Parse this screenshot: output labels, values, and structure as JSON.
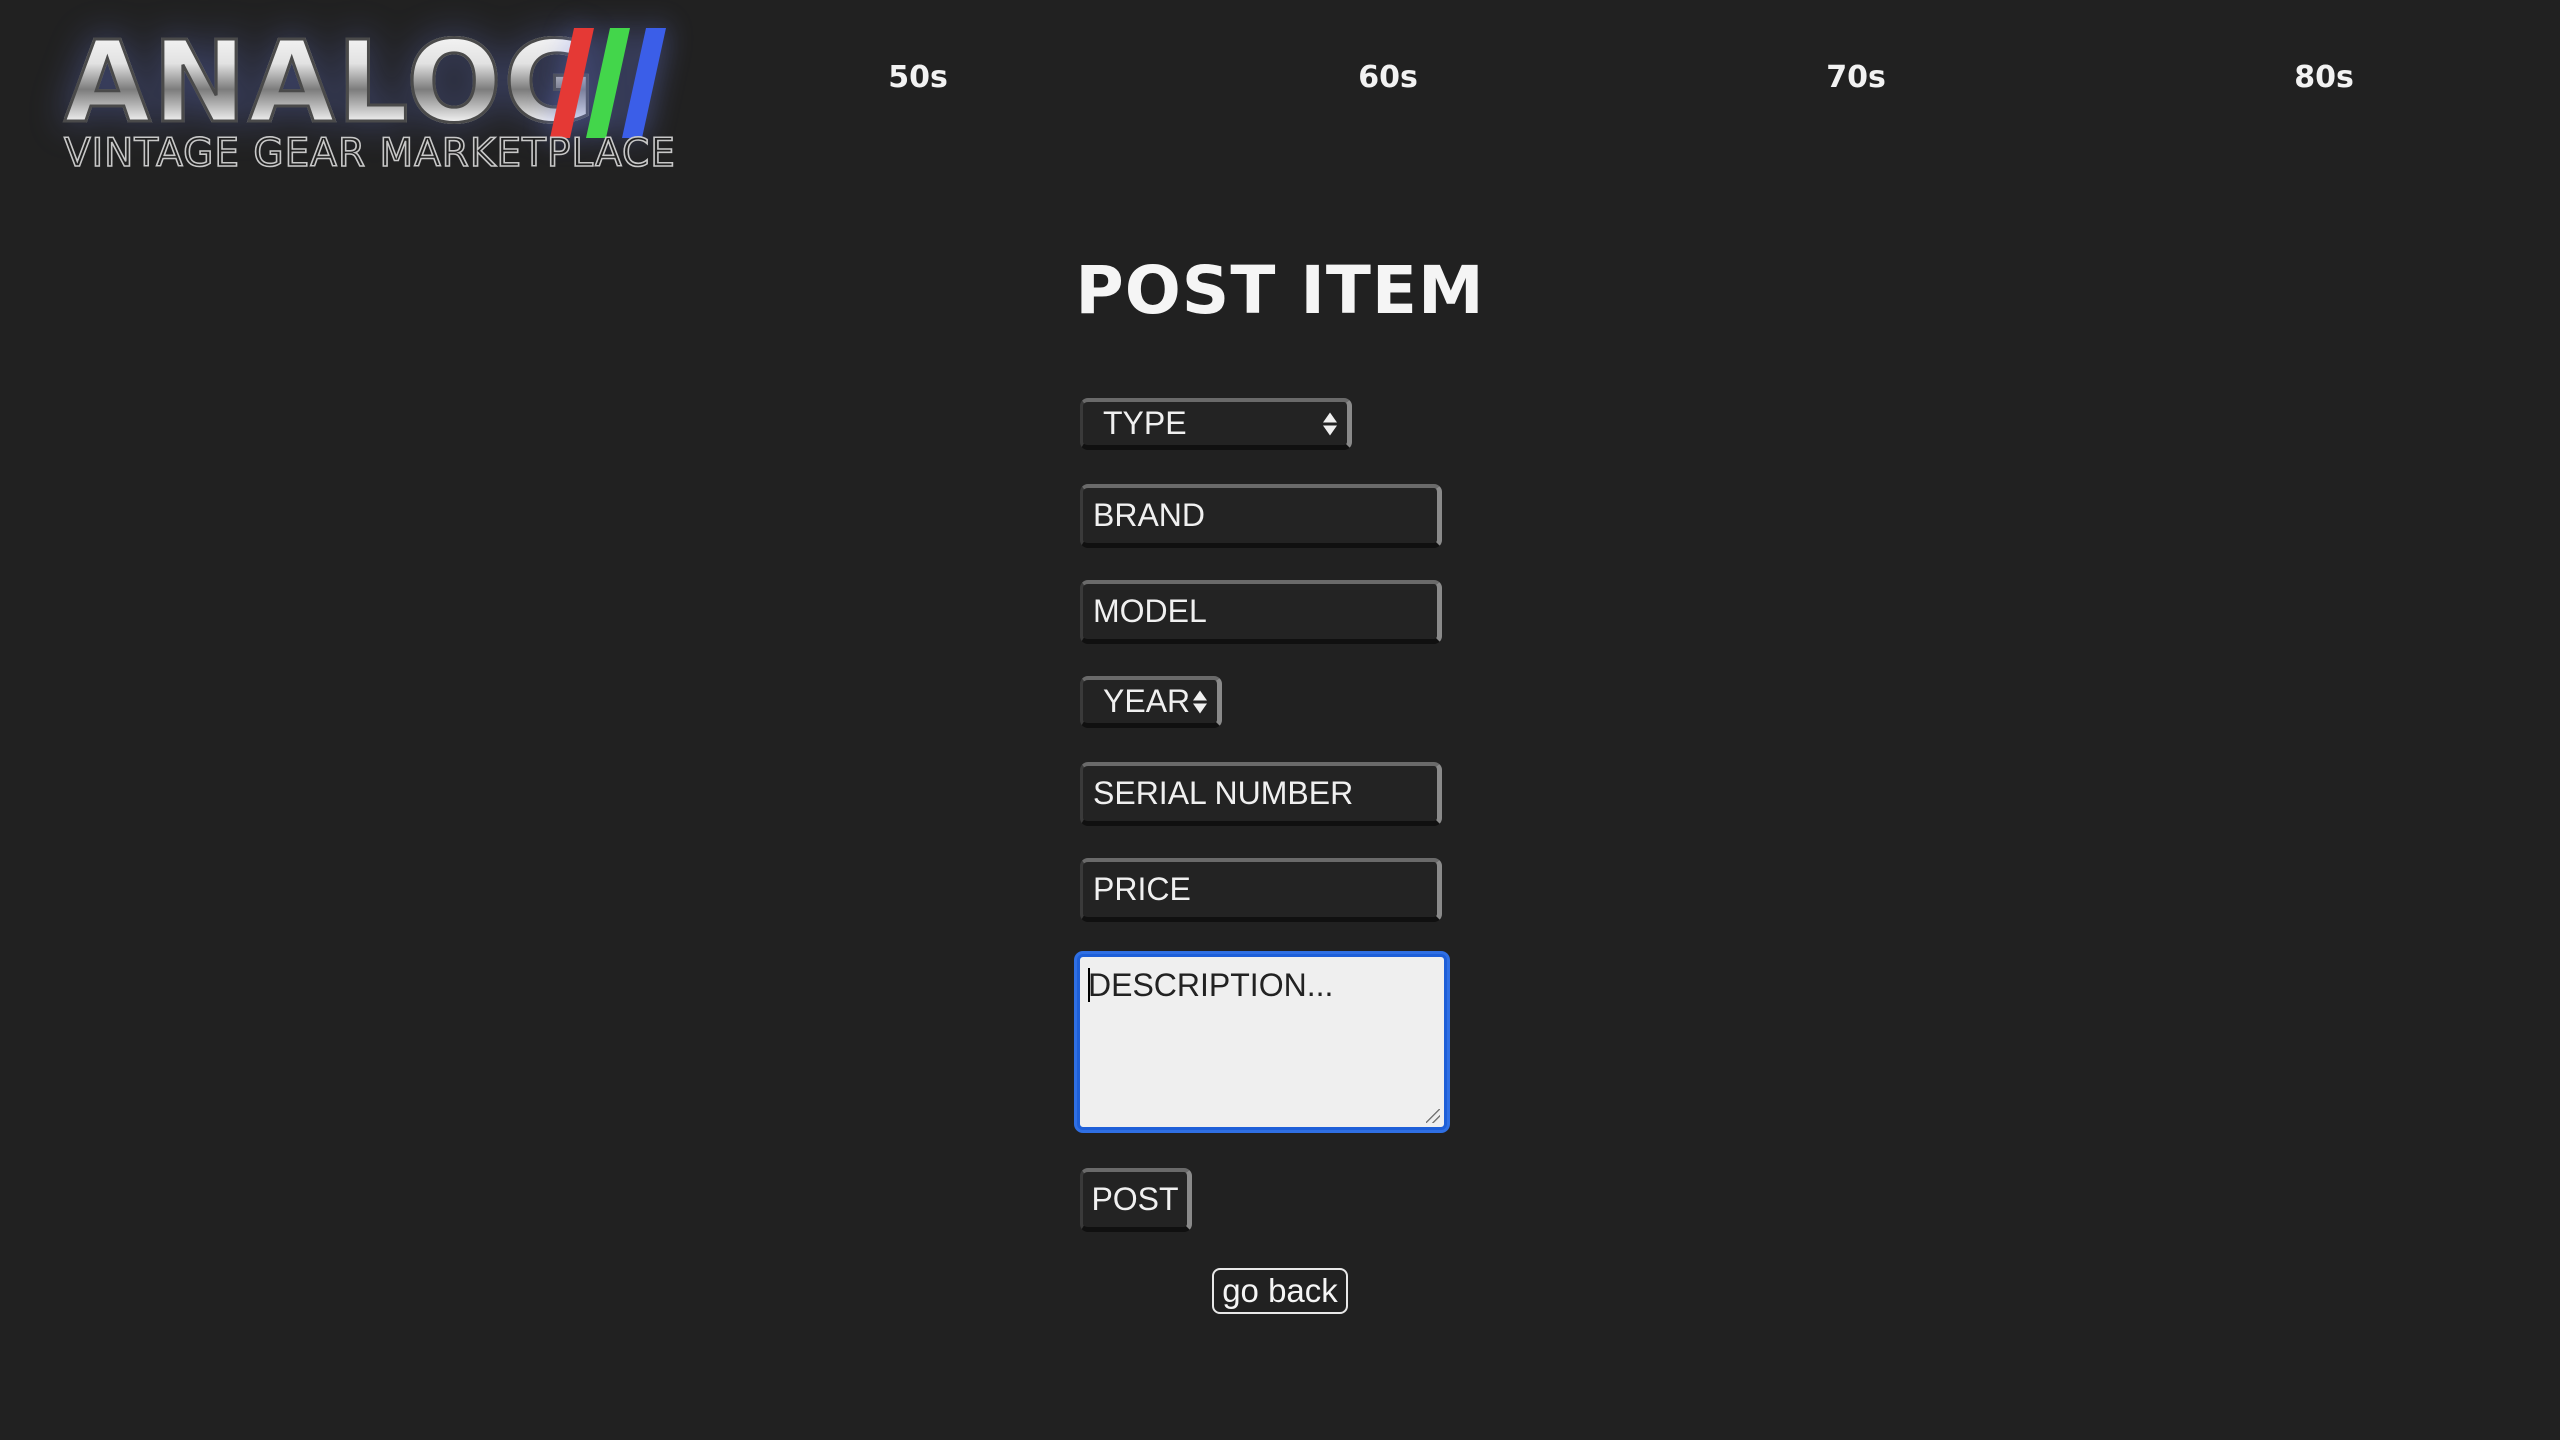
{
  "brand": {
    "name": "ANALOG",
    "tagline": "VINTAGE GEAR MARKETPLACE",
    "stripe_colors": [
      "#e53935",
      "#43d64b",
      "#3b5ee8"
    ]
  },
  "nav": {
    "items": [
      {
        "label": "50s"
      },
      {
        "label": "60s"
      },
      {
        "label": "70s"
      },
      {
        "label": "80s"
      }
    ]
  },
  "form": {
    "title": "POST ITEM",
    "type_select": {
      "selected": "TYPE"
    },
    "brand_field": {
      "placeholder": "BRAND"
    },
    "model_field": {
      "placeholder": "MODEL"
    },
    "year_select": {
      "selected": "YEAR"
    },
    "serial_field": {
      "placeholder": "SERIAL NUMBER"
    },
    "price_field": {
      "placeholder": "PRICE"
    },
    "description_field": {
      "placeholder": "DESCRIPTION..."
    },
    "submit_label": "POST",
    "back_label": "go back"
  },
  "colors": {
    "background": "#212121",
    "focus_ring": "#2f6fe4",
    "text": "#f0f0f0"
  }
}
